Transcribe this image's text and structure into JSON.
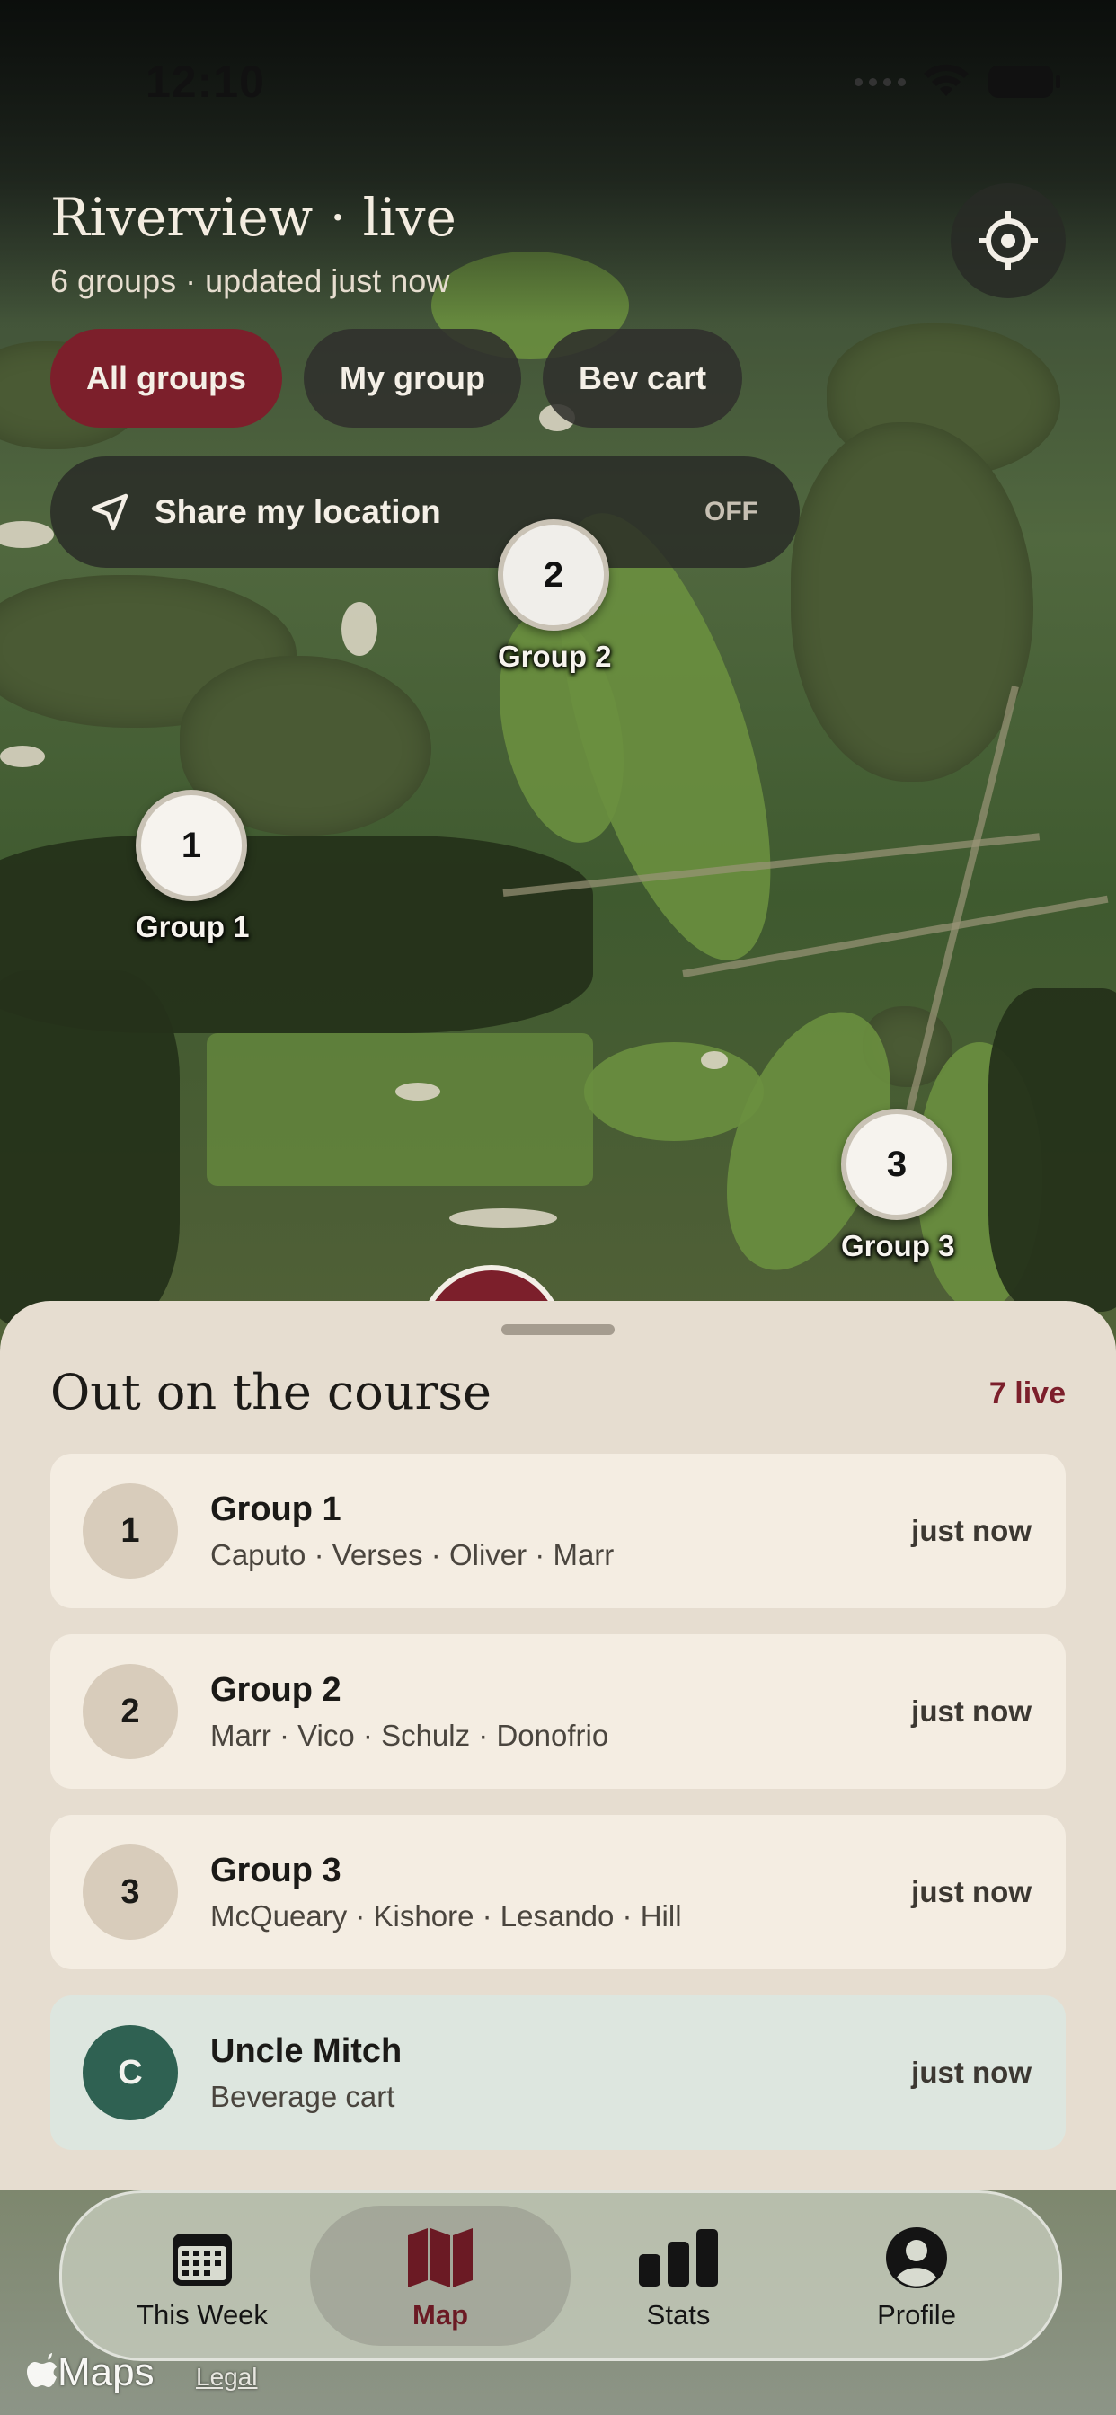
{
  "status_bar": {
    "time": "12:10"
  },
  "header": {
    "title": "Riverview · live",
    "subtitle": "6 groups · updated just now"
  },
  "filters": [
    {
      "label": "All groups",
      "active": true
    },
    {
      "label": "My group",
      "active": false
    },
    {
      "label": "Bev cart",
      "active": false
    }
  ],
  "share_location": {
    "label": "Share my location",
    "state": "OFF"
  },
  "markers": [
    {
      "number": "1",
      "label": "Group 1"
    },
    {
      "number": "2",
      "label": "Group 2"
    },
    {
      "number": "3",
      "label": "Group 3"
    }
  ],
  "sheet": {
    "title": "Out on the course",
    "live_count": "7 live",
    "items": [
      {
        "badge": "1",
        "name": "Group 1",
        "members": "Caputo · Verses · Oliver · Marr",
        "time": "just now"
      },
      {
        "badge": "2",
        "name": "Group 2",
        "members": "Marr · Vico · Schulz · Donofrio",
        "time": "just now"
      },
      {
        "badge": "3",
        "name": "Group 3",
        "members": "McQueary · Kishore · Lesando · Hill",
        "time": "just now"
      },
      {
        "badge": "C",
        "name": "Uncle Mitch",
        "members": "Beverage cart",
        "time": "just now"
      }
    ]
  },
  "tabs": [
    {
      "label": "This Week",
      "icon": "calendar-icon"
    },
    {
      "label": "Map",
      "icon": "map-icon",
      "active": true
    },
    {
      "label": "Stats",
      "icon": "bar-chart-icon"
    },
    {
      "label": "Profile",
      "icon": "person-icon"
    }
  ],
  "map_attribution": {
    "logo": "Maps",
    "legal": "Legal"
  },
  "colors": {
    "accent": "#7c1f2b",
    "sheet": "#e6ddd0",
    "bev_badge": "#2f6152"
  }
}
